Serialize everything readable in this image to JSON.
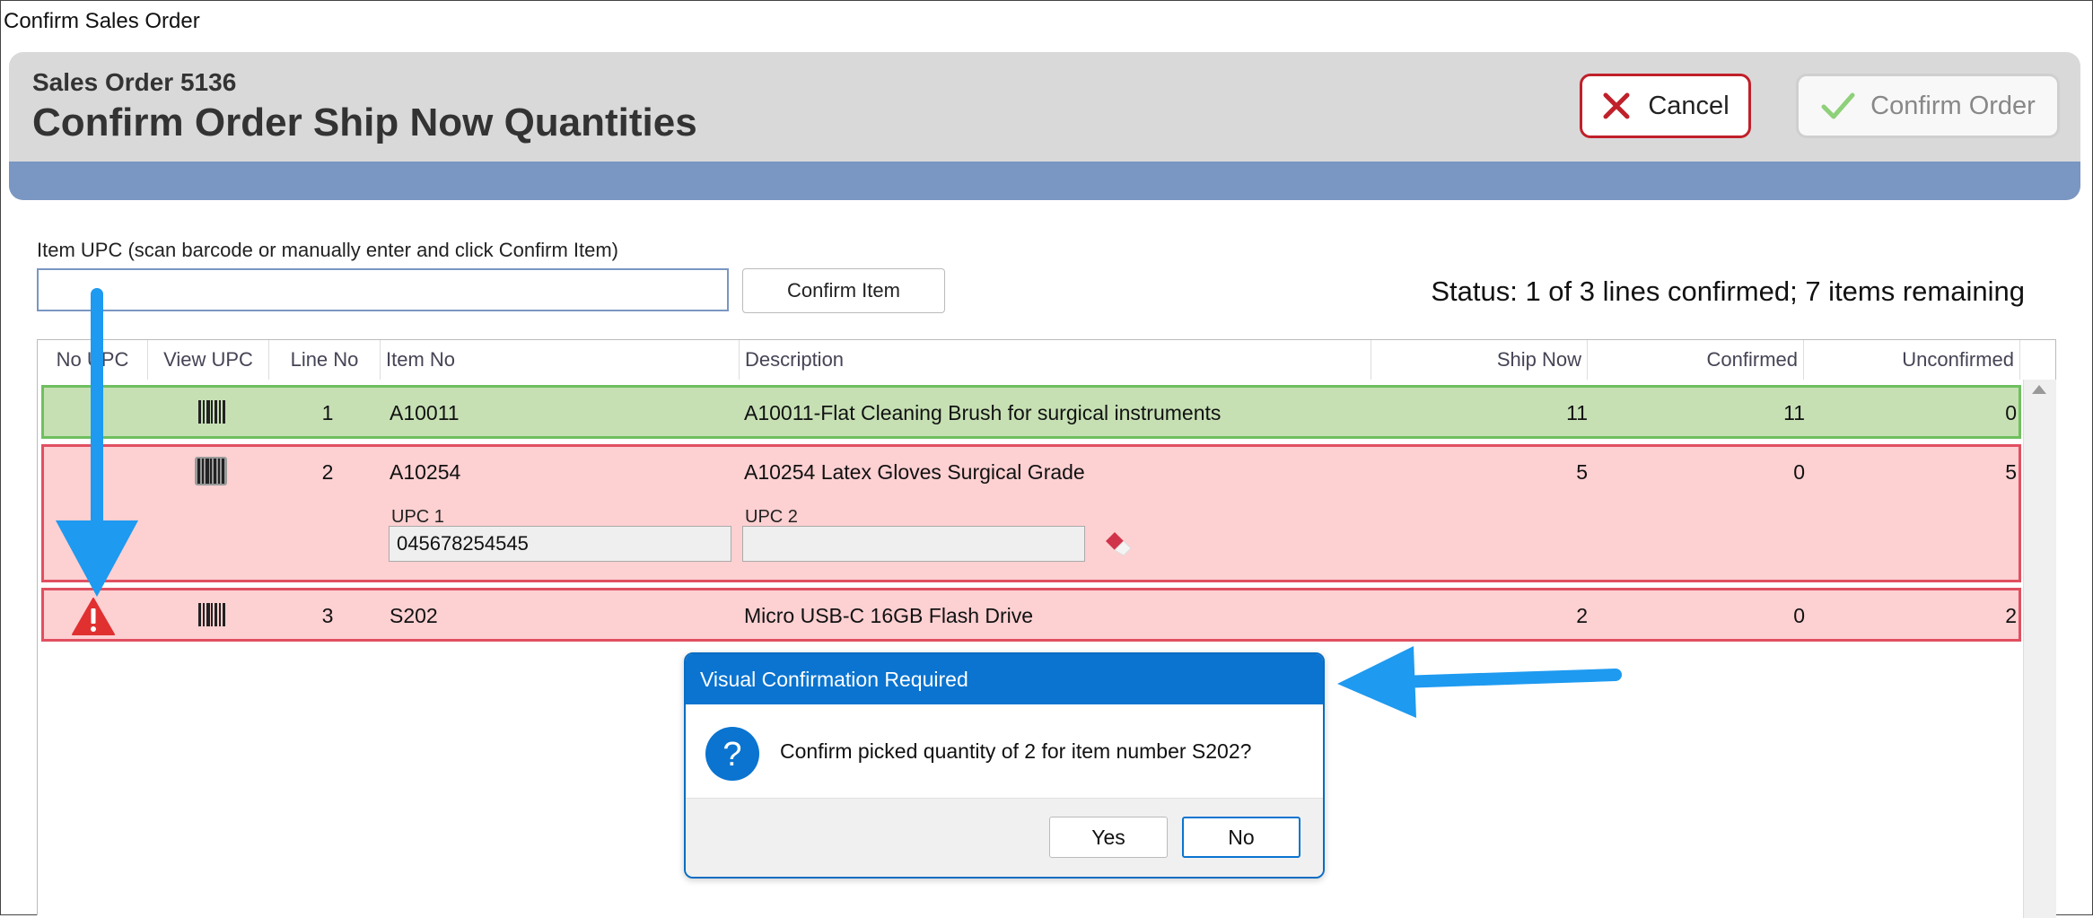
{
  "window": {
    "title": "Confirm Sales Order"
  },
  "header": {
    "sales_order": "Sales Order 5136",
    "title": "Confirm Order Ship Now Quantities",
    "cancel_label": "Cancel",
    "confirm_order_label": "Confirm Order"
  },
  "scan": {
    "label": "Item UPC (scan barcode or manually enter and click Confirm Item)",
    "value": "",
    "confirm_item_label": "Confirm Item",
    "status": "Status: 1 of 3 lines confirmed; 7 items remaining"
  },
  "grid": {
    "columns": [
      "No UPC",
      "View UPC",
      "Line No",
      "Item No",
      "Description",
      "Ship Now",
      "Confirmed",
      "Unconfirmed"
    ],
    "rows": [
      {
        "line": "1",
        "item": "A10011",
        "description": "A10011-Flat Cleaning Brush for surgical instruments",
        "ship_now": "11",
        "confirmed": "11",
        "unconfirmed": "0",
        "state": "confirmed"
      },
      {
        "line": "2",
        "item": "A10254",
        "description": "A10254 Latex Gloves Surgical Grade",
        "ship_now": "5",
        "confirmed": "0",
        "unconfirmed": "5",
        "state": "unconfirmed",
        "upc1_label": "UPC 1",
        "upc1_value": "045678254545",
        "upc2_label": "UPC 2",
        "upc2_value": ""
      },
      {
        "line": "3",
        "item": "S202",
        "description": "Micro USB-C 16GB Flash Drive",
        "ship_now": "2",
        "confirmed": "0",
        "unconfirmed": "2",
        "state": "no-upc"
      }
    ]
  },
  "dialog": {
    "title": "Visual Confirmation Required",
    "message": "Confirm picked quantity of 2 for item number S202?",
    "yes_label": "Yes",
    "no_label": "No"
  },
  "colors": {
    "confirmed_row": "#c6e0b4",
    "unconfirmed_row": "#fdd0d2",
    "band": "#7a96c2",
    "dialog_title": "#0a74d0",
    "annotation_arrow": "#1e9af0",
    "warning": "#e03030"
  },
  "icons": [
    "close-x-icon",
    "checkmark-icon",
    "barcode-icon",
    "warning-triangle-icon",
    "eraser-icon",
    "question-icon",
    "annotation-arrow"
  ]
}
